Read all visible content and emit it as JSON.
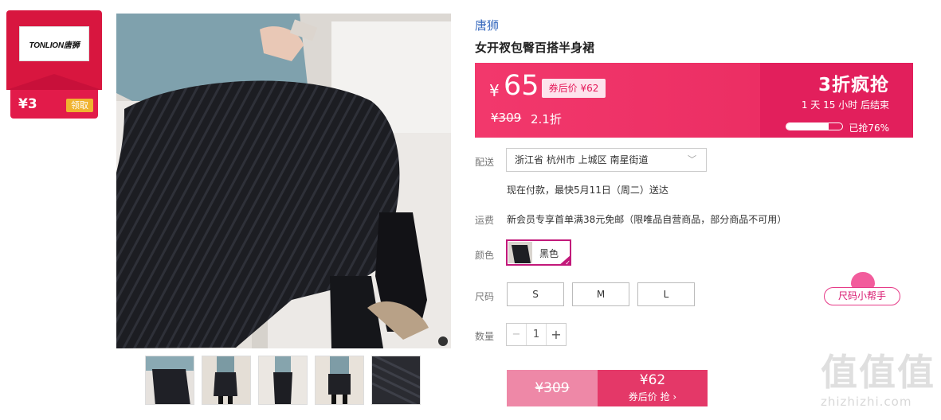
{
  "coupon": {
    "logo_text": "TONLION唐狮",
    "amount": "¥3",
    "claim_label": "领取"
  },
  "brand": "唐狮",
  "product_title": "女开衩包臀百搭半身裙",
  "price_box": {
    "currency": "¥",
    "price": "65",
    "after_coupon": "券后价 ¥62",
    "original_price": "¥309",
    "discount": "2.1折",
    "promo_title": "3折疯抢",
    "countdown": "1 天 15 小时 后结束",
    "progress_fraction": 0.76,
    "grabbed": "已抢76%"
  },
  "shipping": {
    "label": "配送",
    "address": "浙江省 杭州市 上城区 南星街道",
    "delivery_note": "现在付款，最快5月11日（周二）送达"
  },
  "freight": {
    "label": "运费",
    "text": "新会员专享首单满38元免邮（限唯品自营商品，部分商品不可用）"
  },
  "color": {
    "label": "颜色",
    "selected": "黑色"
  },
  "size": {
    "label": "尺码",
    "options": [
      "S",
      "M",
      "L"
    ],
    "helper": "尺码小帮手"
  },
  "quantity": {
    "label": "数量",
    "value": "1",
    "minus": "−",
    "plus": "+"
  },
  "buy": {
    "original": "¥309",
    "price": "¥62",
    "sub": "券后价 抢 ›"
  },
  "watermark": {
    "big": "值值值",
    "small": "zhizhizhi.com"
  },
  "colors": {
    "accent": "#e5195a",
    "brand_link": "#3b6cbf",
    "coupon_red": "#d8163f"
  }
}
